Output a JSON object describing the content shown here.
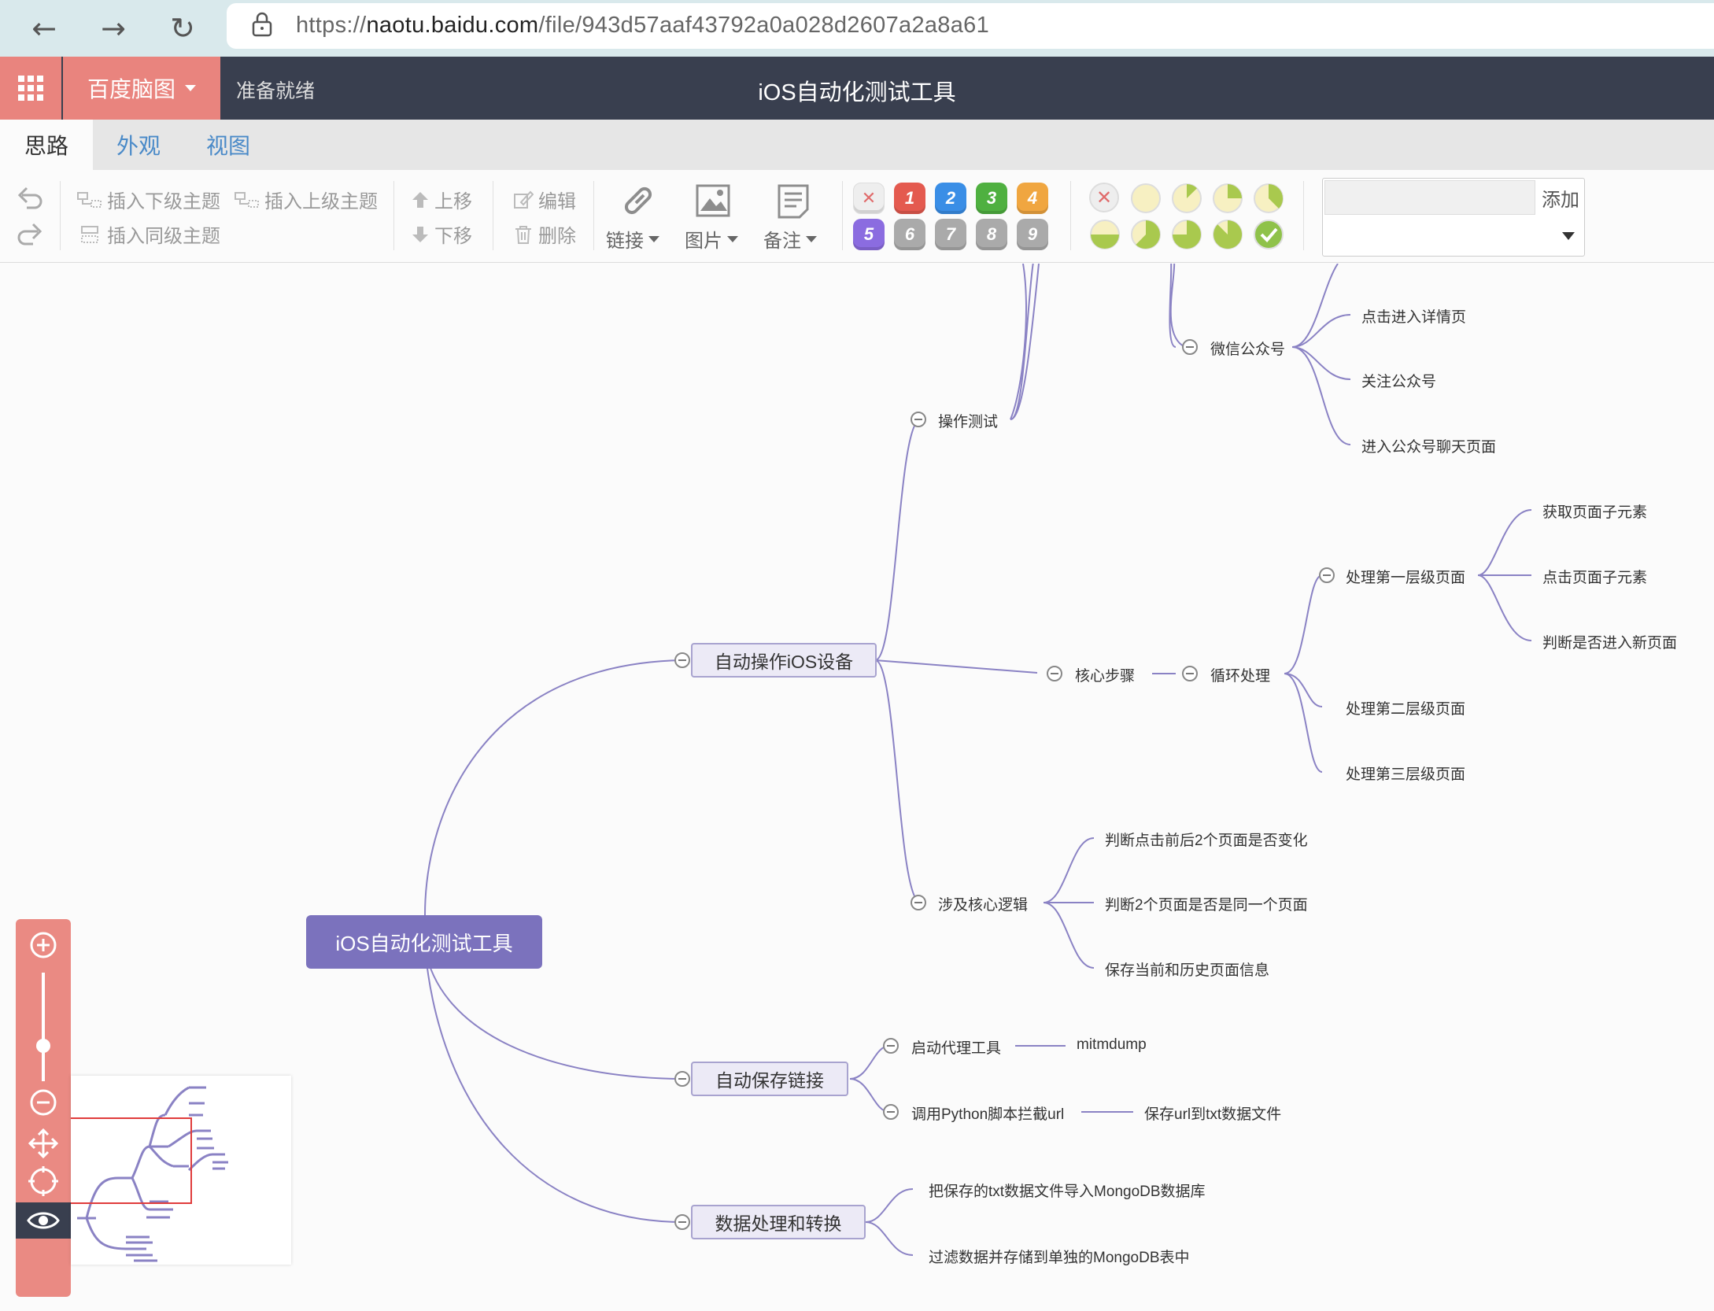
{
  "browser": {
    "url_prefix": "https://",
    "url_domain": "naotu.baidu.com",
    "url_path": "/file/943d57aaf43792a0a028d2607a2a8a61"
  },
  "app": {
    "brand": "百度脑图",
    "status": "准备就绪",
    "title": "iOS自动化测试工具"
  },
  "tabs": [
    "思路",
    "外观",
    "视图"
  ],
  "toolbar": {
    "insert_child": "插入下级主题",
    "insert_parent": "插入上级主题",
    "insert_sibling": "插入同级主题",
    "move_up": "上移",
    "move_down": "下移",
    "edit": "编辑",
    "delete": "删除",
    "link": "链接",
    "image": "图片",
    "note": "备注",
    "priorities": [
      "1",
      "2",
      "3",
      "4",
      "5",
      "6",
      "7",
      "8",
      "9"
    ],
    "resource_add": "添加"
  },
  "colors": {
    "accent": "#e9847e",
    "header": "#393f4f",
    "root": "#7b72bd",
    "line": "#8a82c4"
  },
  "mindmap": {
    "root": "iOS自动化测试工具",
    "b1": "自动操作iOS设备",
    "b1_op": "操作测试",
    "b1_op_wx": "微信公众号",
    "b1_op_wx_1": "点击进入详情页",
    "b1_op_wx_2": "关注公众号",
    "b1_op_wx_3": "进入公众号聊天页面",
    "b1_core": "核心步骤",
    "b1_loop": "循环处理",
    "b1_l1": "处理第一层级页面",
    "b1_l1_1": "获取页面子元素",
    "b1_l1_2": "点击页面子元素",
    "b1_l1_3": "判断是否进入新页面",
    "b1_l2": "处理第二层级页面",
    "b1_l3": "处理第三层级页面",
    "b1_logic": "涉及核心逻辑",
    "b1_logic_1": "判断点击前后2个页面是否变化",
    "b1_logic_2": "判断2个页面是否是同一个页面",
    "b1_logic_3": "保存当前和历史页面信息",
    "b2": "自动保存链接",
    "b2_proxy": "启动代理工具",
    "b2_proxy_1": "mitmdump",
    "b2_py": "调用Python脚本拦截url",
    "b2_py_1": "保存url到txt数据文件",
    "b3": "数据处理和转换",
    "b3_1": "把保存的txt数据文件导入MongoDB数据库",
    "b3_2": "过滤数据并存储到单独的MongoDB表中"
  }
}
